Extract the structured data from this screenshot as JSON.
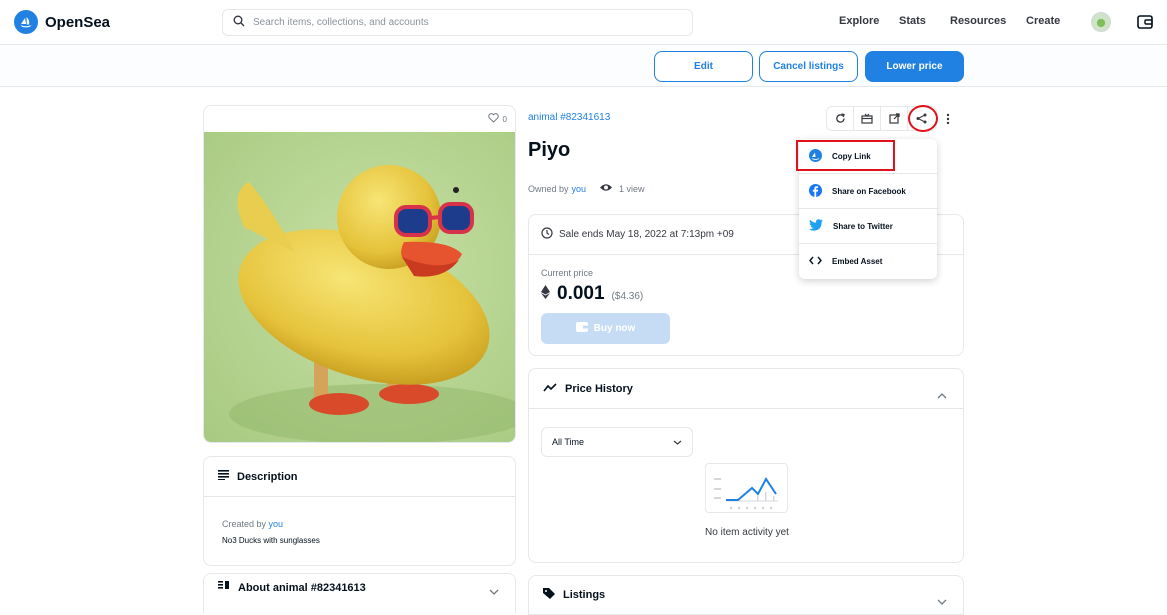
{
  "header": {
    "brand": "OpenSea",
    "search_placeholder": "Search items, collections, and accounts",
    "nav": [
      "Explore",
      "Stats",
      "Resources",
      "Create"
    ]
  },
  "action_bar": {
    "edit": "Edit",
    "cancel_listings": "Cancel listings",
    "lower_price": "Lower price"
  },
  "item": {
    "favorites": "0",
    "collection": "animal #82341613",
    "name": "Piyo",
    "owned_by_prefix": "Owned by",
    "owner": "you",
    "views": "1 view",
    "sale_ends": "Sale ends May 18, 2022 at 7:13pm +09",
    "current_price_label": "Current price",
    "price": "0.001",
    "price_usd": "($4.36)",
    "buy_now": "Buy now"
  },
  "share_menu": {
    "items": [
      "Copy Link",
      "Share on Facebook",
      "Share to Twitter",
      "Embed Asset"
    ]
  },
  "description": {
    "title": "Description",
    "created_by_prefix": "Created by",
    "creator": "you",
    "text": "No3 Ducks with sunglasses"
  },
  "about": {
    "title": "About animal #82341613"
  },
  "price_history": {
    "title": "Price History",
    "range": "All Time",
    "empty": "No item activity yet"
  },
  "listings": {
    "title": "Listings"
  },
  "colors": {
    "accent": "#2081e2",
    "highlight": "#e0121b"
  }
}
